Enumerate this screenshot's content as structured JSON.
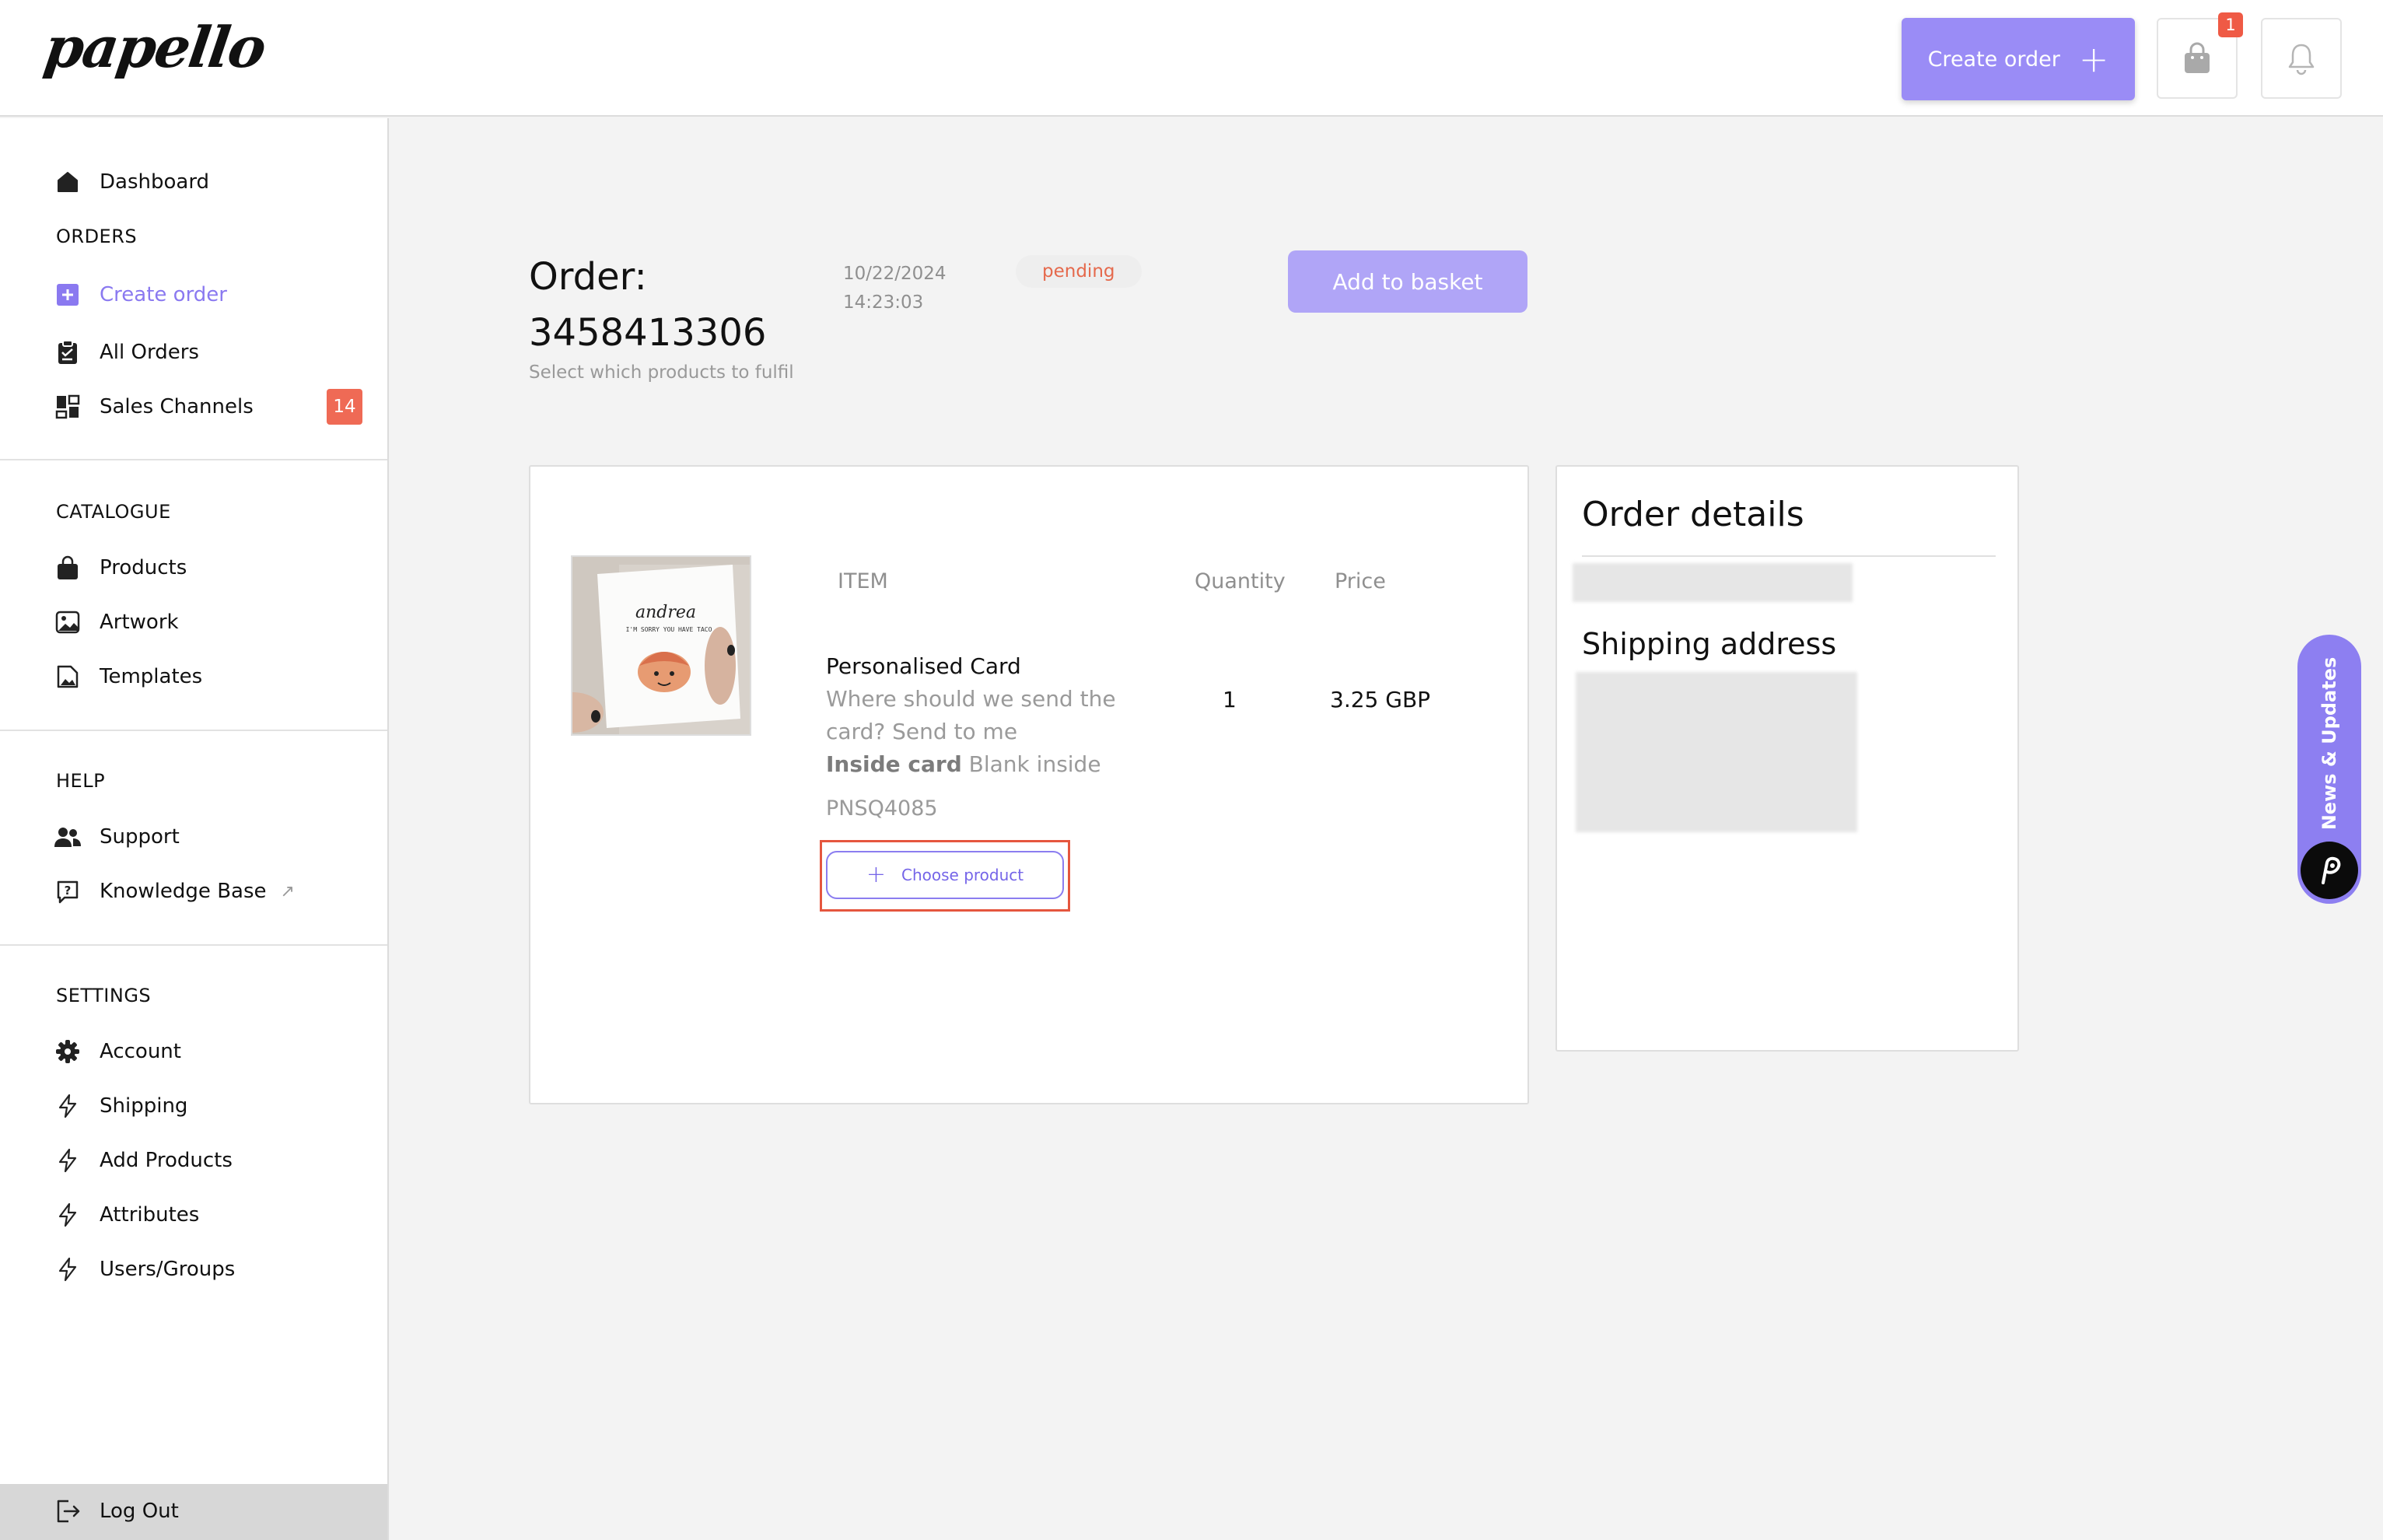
{
  "header": {
    "logo": "papello",
    "create_order_label": "Create order",
    "cart_count": "1"
  },
  "sidebar": {
    "dashboard": "Dashboard",
    "orders_section": "ORDERS",
    "create_order": "Create order",
    "all_orders": "All Orders",
    "sales_channels": "Sales Channels",
    "sales_channels_count": "14",
    "catalogue_section": "CATALOGUE",
    "products": "Products",
    "artwork": "Artwork",
    "templates": "Templates",
    "help_section": "HELP",
    "support": "Support",
    "knowledge_base": "Knowledge Base",
    "settings_section": "SETTINGS",
    "account": "Account",
    "shipping": "Shipping",
    "add_products": "Add Products",
    "attributes": "Attributes",
    "users_groups": "Users/Groups",
    "log_out": "Log Out"
  },
  "order": {
    "title_line1": "Order:",
    "title_line2": "3458413306",
    "subtitle": "Select which products to fulfil",
    "date": "10/22/2024",
    "time": "14:23:03",
    "status": "pending",
    "add_to_basket": "Add to basket"
  },
  "items": {
    "headers": {
      "item": "ITEM",
      "quantity": "Quantity",
      "price": "Price"
    },
    "product": {
      "name": "Personalised Card",
      "attr1_label": "Where should we send the card?",
      "attr1_value": "Send to me",
      "attr2_label": "Inside card",
      "attr2_value": "Blank inside",
      "sku": "PNSQ4085",
      "quantity": "1",
      "price": "3.25 GBP",
      "thumb_text_name": "andrea",
      "thumb_text_line": "I'M SORRY YOU HAVE TACO"
    },
    "choose_product": "Choose product"
  },
  "details": {
    "title": "Order details",
    "shipping_title": "Shipping address"
  },
  "news_tab": {
    "label": "News & Updates"
  },
  "colors": {
    "accent": "#9a8cf6",
    "badge": "#ef5a45",
    "status_text": "#e5694c"
  }
}
